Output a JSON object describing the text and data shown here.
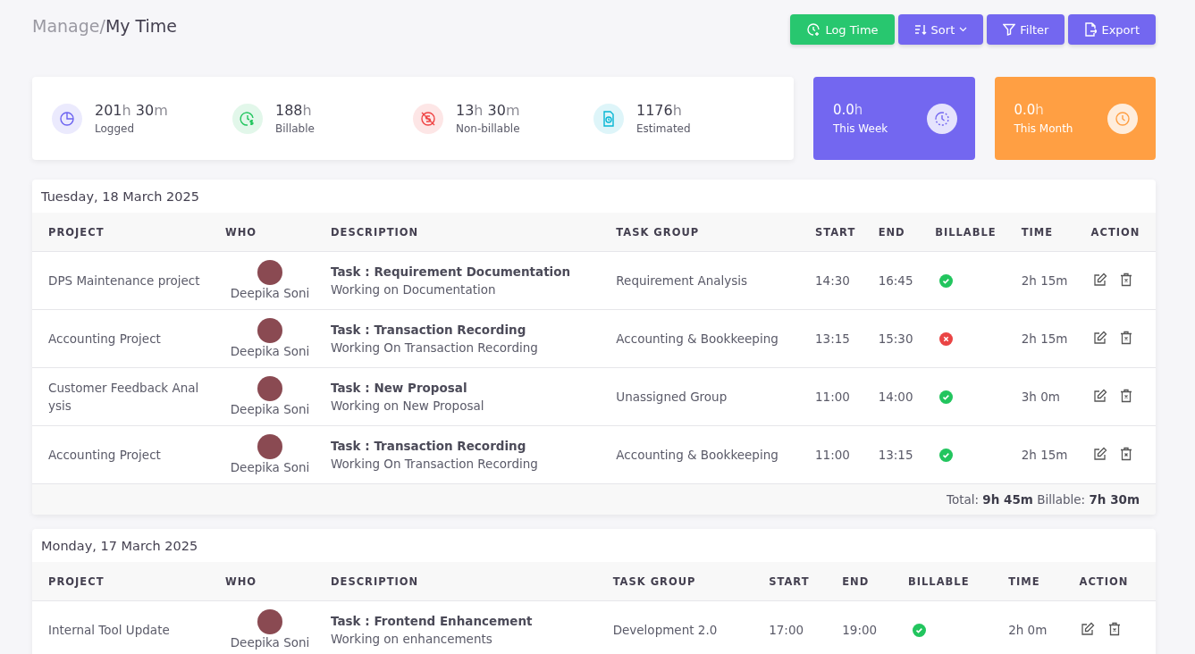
{
  "breadcrumb": {
    "parent": "Manage/",
    "current": "My Time"
  },
  "actions": [
    {
      "kind": "log",
      "label": "Log Time"
    },
    {
      "kind": "sort",
      "label": "Sort"
    },
    {
      "kind": "filter",
      "label": "Filter"
    },
    {
      "kind": "export",
      "label": "Export"
    }
  ],
  "stats": [
    {
      "kind": "pie",
      "color": "#6c63f0",
      "parts": [
        {
          "number": "201",
          "unit": "h"
        },
        {
          "number": "30",
          "unit": "m"
        }
      ],
      "label": "Logged"
    },
    {
      "kind": "money",
      "color": "#22c55e",
      "parts": [
        {
          "number": "188",
          "unit": "h"
        }
      ],
      "label": "Billable"
    },
    {
      "kind": "nomoney",
      "color": "#ef4444",
      "parts": [
        {
          "number": "13",
          "unit": "h"
        },
        {
          "number": "30",
          "unit": "m"
        }
      ],
      "label": "Non-billable"
    },
    {
      "kind": "doc",
      "color": "#06b6d4",
      "parts": [
        {
          "number": "1176",
          "unit": "h"
        }
      ],
      "label": "Estimated"
    }
  ],
  "summary_cards": [
    {
      "kind": "week",
      "color": "#7367f0",
      "number": "0.0",
      "unit": "h",
      "label": "This Week"
    },
    {
      "kind": "month",
      "color": "#ff9f43",
      "number": "0.0",
      "unit": "h",
      "label": "This Month"
    }
  ],
  "days": [
    {
      "date": "Tuesday, 18 March 2025",
      "columns": [
        "PROJECT",
        "WHO",
        "DESCRIPTION",
        "TASK GROUP",
        "START",
        "END",
        "BILLABLE",
        "TIME",
        "ACTION"
      ],
      "rows": [
        {
          "project": "DPS Maintenance project",
          "who": "Deepika Soni",
          "task": "Task : Requirement Documentation",
          "note": "Working on Documentation",
          "group": "Requirement Analysis",
          "start": "14:30",
          "end": "16:45",
          "billable": true,
          "time": "2h 15m"
        },
        {
          "project": "Accounting Project",
          "who": "Deepika Soni",
          "task": "Task : Transaction Recording",
          "note": "Working On Transaction Recording",
          "group": "Accounting & Bookkeeping",
          "start": "13:15",
          "end": "15:30",
          "billable": false,
          "time": "2h 15m"
        },
        {
          "project": "Customer Feedback Anal ysis",
          "who": "Deepika Soni",
          "task": "Task : New Proposal",
          "note": "Working on New Proposal",
          "group": "Unassigned Group",
          "start": "11:00",
          "end": "14:00",
          "billable": true,
          "time": "3h 0m"
        },
        {
          "project": "Accounting Project",
          "who": "Deepika Soni",
          "task": "Task : Transaction Recording",
          "note": "Working On Transaction Recording",
          "group": "Accounting & Bookkeeping",
          "start": "11:00",
          "end": "13:15",
          "billable": true,
          "time": "2h 15m"
        }
      ],
      "footer": "Total: **9h 45m** Billable: **7h 30m**"
    },
    {
      "date": "Monday, 17 March 2025",
      "columns": [
        "PROJECT",
        "WHO",
        "DESCRIPTION",
        "TASK GROUP",
        "START",
        "END",
        "BILLABLE",
        "TIME",
        "ACTION"
      ],
      "rows": [
        {
          "project": "Internal Tool Update",
          "who": "Deepika Soni",
          "task": "Task : Frontend Enhancement",
          "note": "Working on enhancements",
          "group": "Development 2.0",
          "start": "17:00",
          "end": "19:00",
          "billable": true,
          "time": "2h 0m"
        }
      ]
    }
  ]
}
